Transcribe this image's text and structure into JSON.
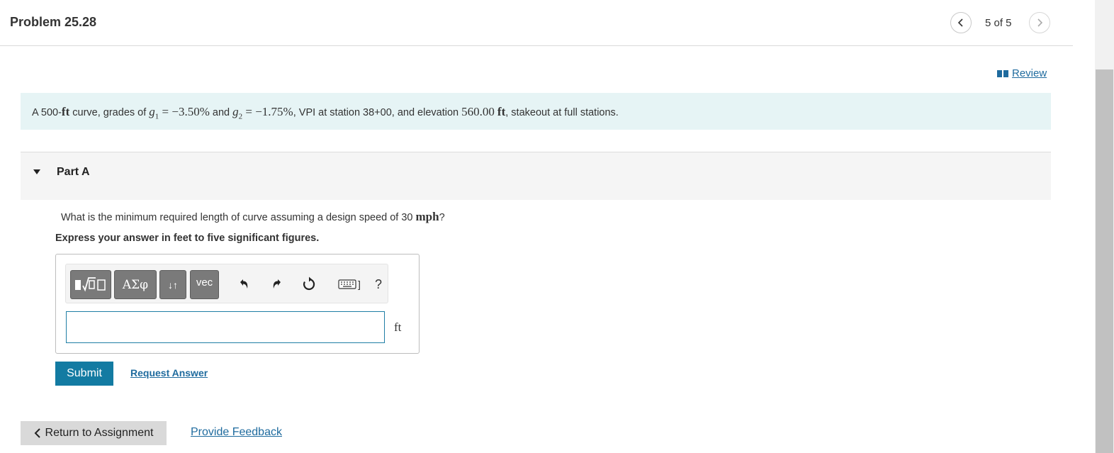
{
  "header": {
    "title": "Problem 25.28",
    "page_count": "5 of 5",
    "prev_icon": "chevron-left-icon",
    "next_icon": "chevron-right-icon"
  },
  "review": {
    "label": " Review",
    "icon": "book-icon"
  },
  "problem": {
    "t1": "A 500-",
    "m1": "ft",
    "t2": " curve, grades of ",
    "g1": "g",
    "g1_sub": "1",
    "eq1": " = −3.50%",
    "t3": " and ",
    "g2": "g",
    "g2_sub": "2",
    "eq2": " = −1.75%",
    "t4": ", VPI at station 38+00, and elevation ",
    "m2": "560.00",
    "m3": "ft",
    "t5": ", stakeout at full stations."
  },
  "part": {
    "label": "Part A"
  },
  "question": {
    "text": "What is the minimum required length of curve assuming a design speed of 30 ",
    "unit": "mph",
    "end": "?",
    "instruction": "Express your answer in feet to five significant figures."
  },
  "toolbar": {
    "greek": "ΑΣφ",
    "arrows": "↓↑",
    "vec": "vec",
    "help": "?",
    "keyboard_bracket": "]"
  },
  "answer": {
    "value": "",
    "placeholder": "",
    "unit": "ft"
  },
  "actions": {
    "submit": "Submit",
    "request": "Request Answer",
    "return": "Return to Assignment",
    "feedback": "Provide Feedback"
  },
  "colors": {
    "accent": "#137ba2",
    "link": "#1f6b9e",
    "problem_bg": "#e6f4f5"
  }
}
